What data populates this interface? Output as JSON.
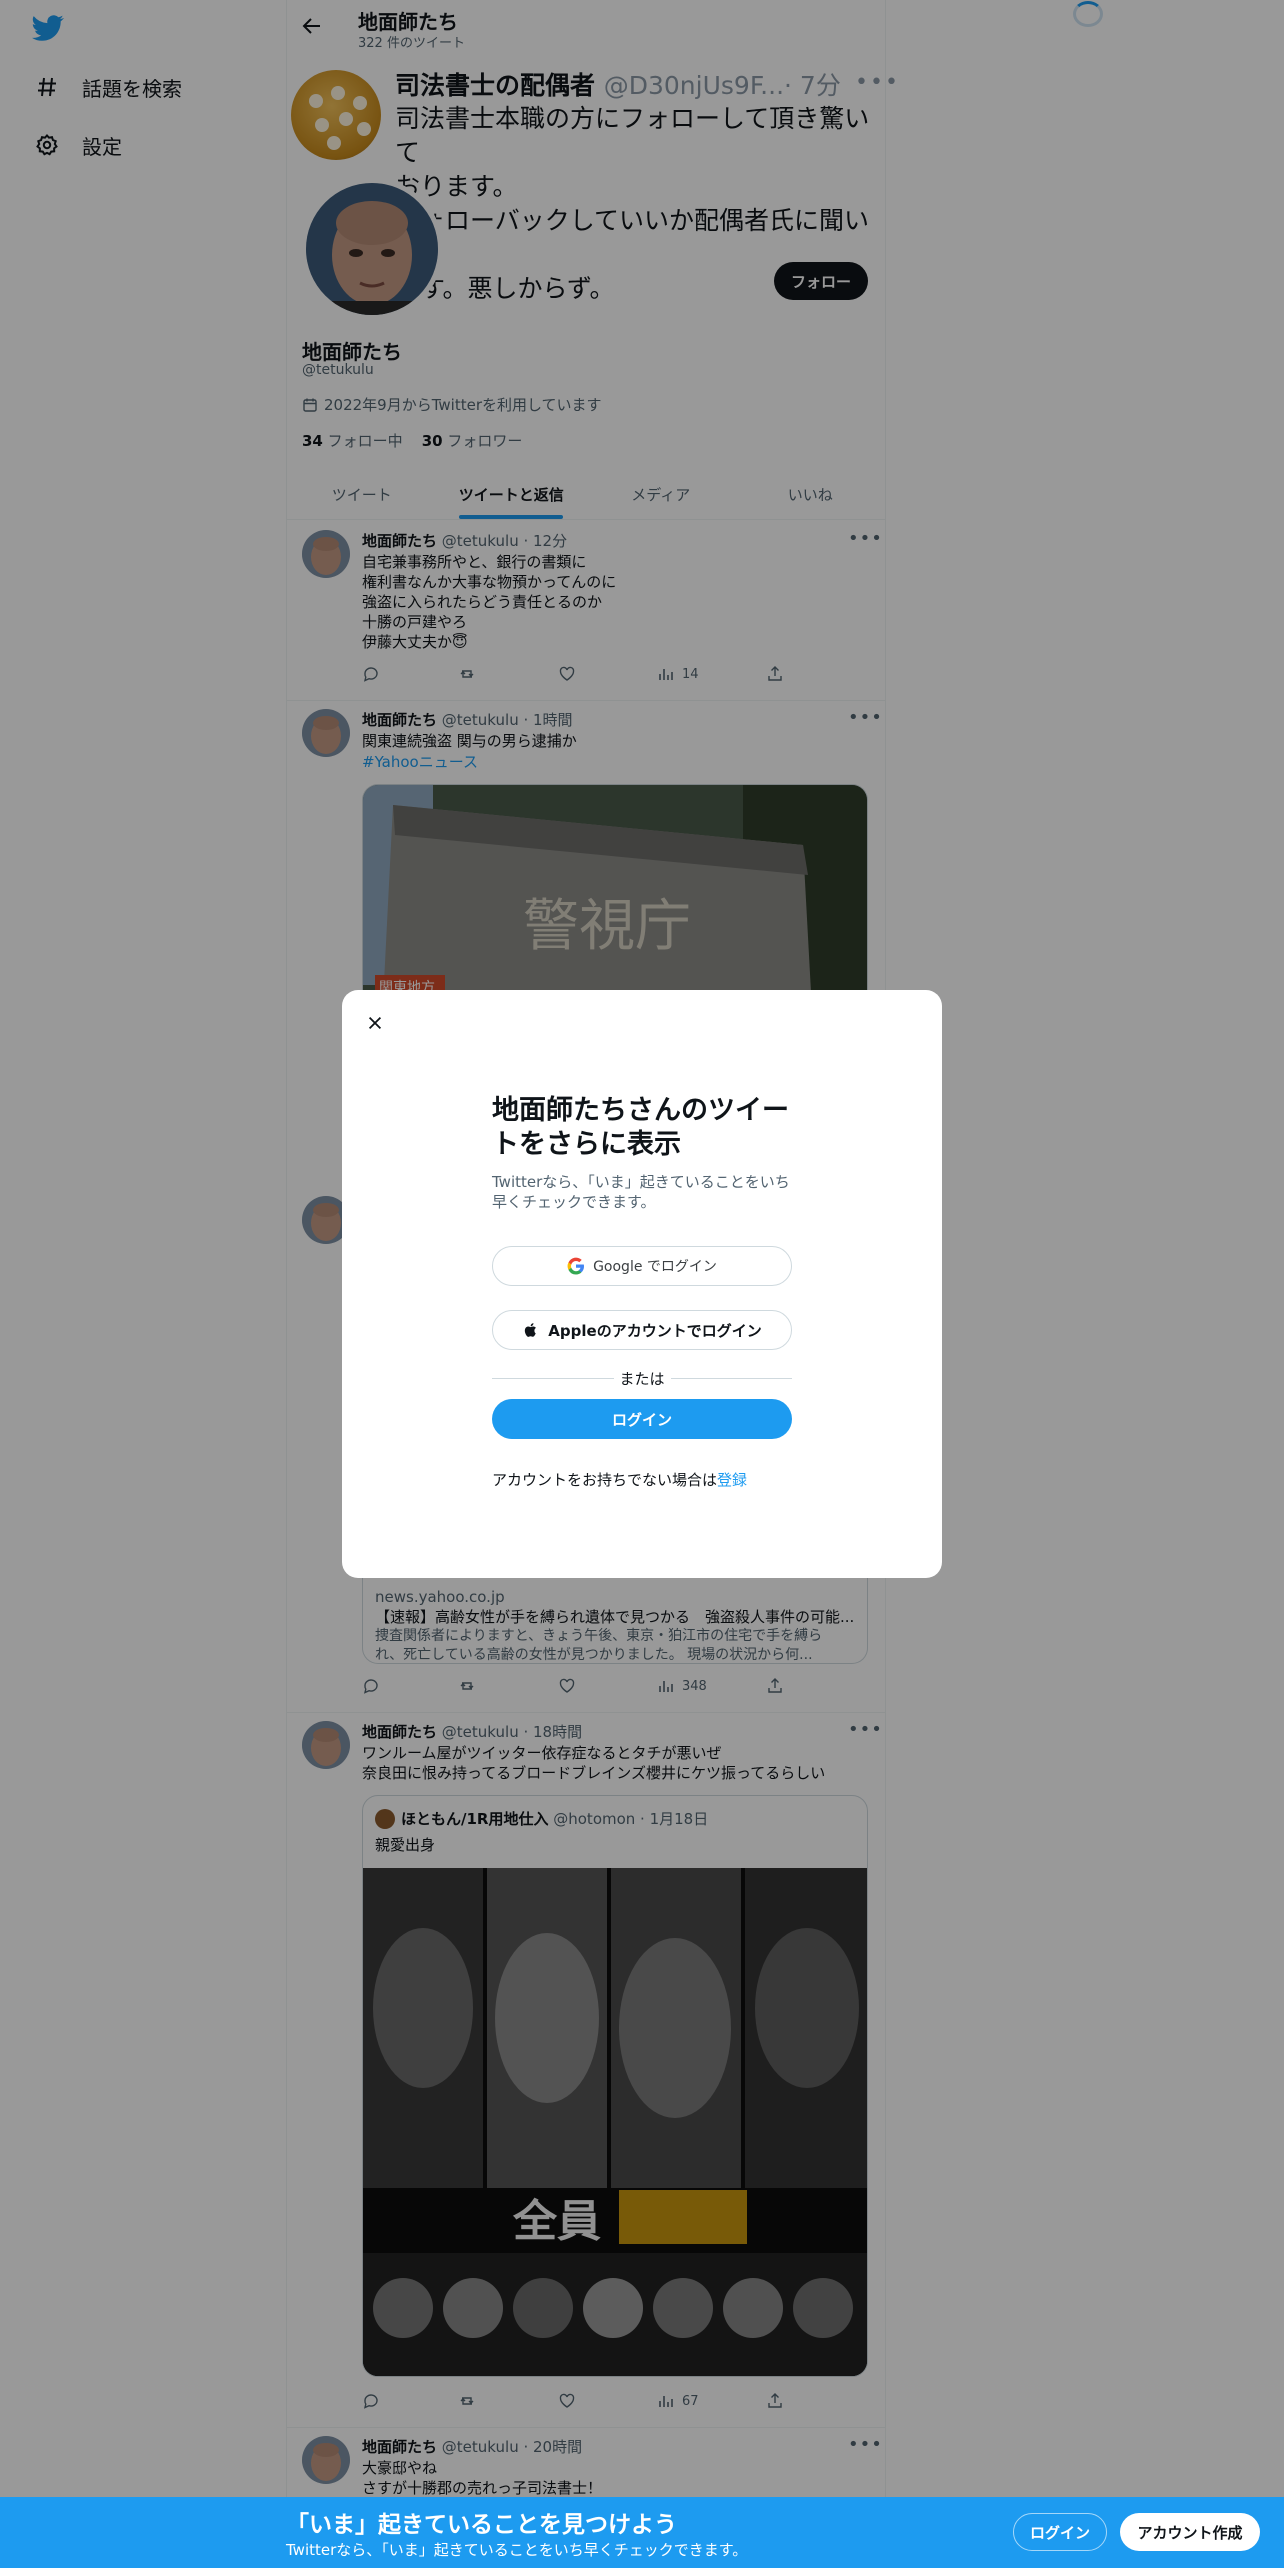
{
  "nav": {
    "items": [
      {
        "label": "話題を検索",
        "icon": "hashtag-icon"
      },
      {
        "label": "設定",
        "icon": "gear-icon"
      }
    ]
  },
  "header": {
    "title": "地面師たち",
    "subtitle": "322 件のツイート"
  },
  "big_tweet": {
    "name": "司法書士の配偶者",
    "handle": "@D30njUs9F...",
    "time": "· 7分",
    "text": "司法書士本職の方にフォローして頂き驚いて\nおります。\nフォローバックしていいか配偶者氏に聞いて\nます。悪しからず。"
  },
  "profile": {
    "follow_label": "フォロー",
    "name": "地面師たち",
    "handle": "@tetukulu",
    "joined": "2022年9月からTwitterを利用しています",
    "following_count": "34",
    "following_label": "フォロー中",
    "followers_count": "30",
    "followers_label": "フォロワー"
  },
  "tabs": [
    "ツイート",
    "ツイートと返信",
    "メディア",
    "いいね"
  ],
  "tweets": [
    {
      "name": "地面師たち",
      "meta": "@tetukulu · 12分",
      "text": "自宅兼事務所やと、銀行の書類に\n権利書なんか大事な物預かってんのに\n強盗に入られたらどう責任とるのか\n十勝の戸建やろ\n伊藤大丈夫か😇",
      "views": "14"
    },
    {
      "name": "地面師たち",
      "meta": "@tetukulu · 1時間",
      "text": "関東連続強盗 関与の男ら逮捕か",
      "link": "#Yahooニュース",
      "image_caption": "関東地方",
      "image_sign": "警視庁"
    },
    {
      "card_domain": "news.yahoo.co.jp",
      "card_title": "【速報】高齢女性が手を縛られ遺体で見つかる　強盗殺人事件の可能...",
      "card_desc": "捜査関係者によりますと、きょう午後、東京・狛江市の住宅で手を縛ら\nれ、死亡している高齢の女性が見つかりました。 現場の状況から何...",
      "views": "348"
    },
    {
      "name": "地面師たち",
      "meta": "@tetukulu · 18時間",
      "text": "ワンルーム屋がツイッター依存症なるとタチが悪いぜ\n奈良田に恨み持ってるブロードブレインズ櫻井にケツ振ってるらしい",
      "quote_name": "ほともん/1R用地仕入",
      "quote_meta": "@hotomon · 1月18日",
      "quote_text": "親愛出身",
      "quote_poster_text": "全員",
      "views": "67"
    },
    {
      "name": "地面師たち",
      "meta": "@tetukulu · 20時間",
      "text": "大豪邸やね\nさすが十勝郡の売れっ子司法書士！"
    }
  ],
  "modal": {
    "title": "地面師たちさんのツイートをさらに表示",
    "subtitle": "Twitterなら、「いま」起きていることをいち早くチェックできます。",
    "google_label": "Google でログイン",
    "apple_label": "Appleのアカウントでログイン",
    "or_label": "または",
    "login_label": "ログイン",
    "signup_prefix": "アカウントをお持ちでない場合は",
    "signup_link": "登録"
  },
  "bottom_bar": {
    "title": "「いま」起きていることを見つけよう",
    "subtitle": "Twitterなら、「いま」起きていることをいち早くチェックできます。",
    "login_label": "ログイン",
    "signup_label": "アカウント作成"
  },
  "colors": {
    "accent": "#1d9bf0",
    "text": "#0f1419",
    "secondary": "#536471"
  }
}
